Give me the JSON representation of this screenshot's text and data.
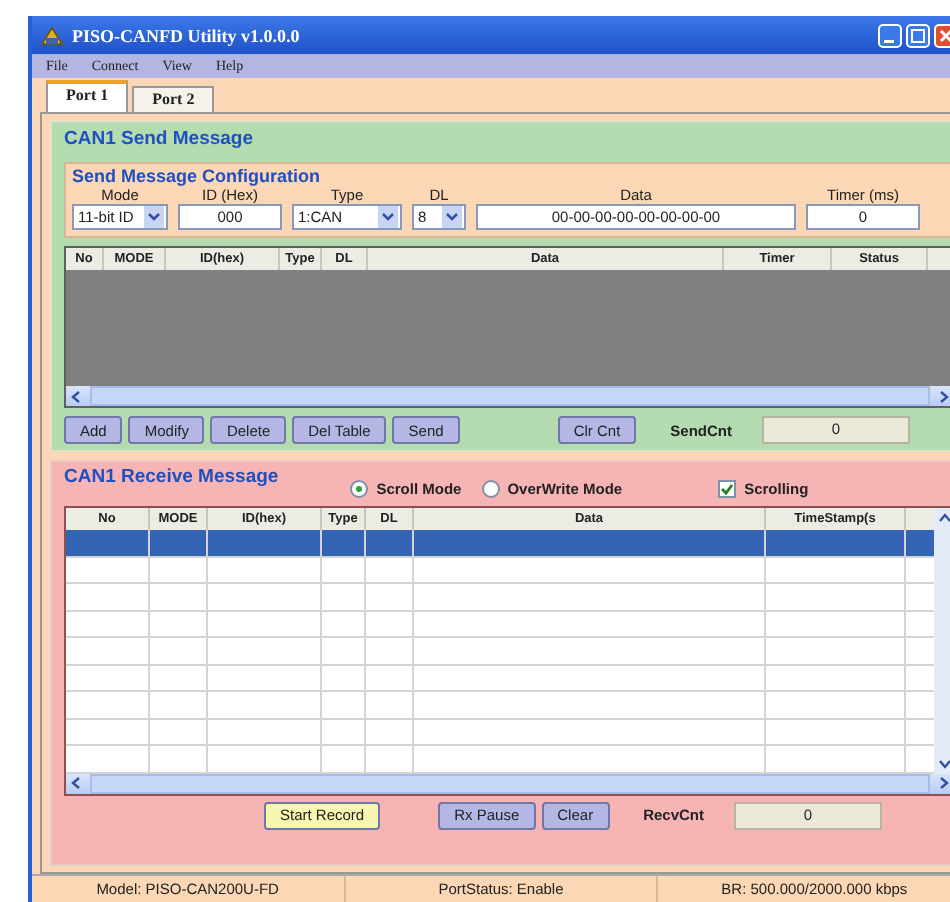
{
  "window": {
    "title": "PISO-CANFD Utility v1.0.0.0"
  },
  "menu": [
    "File",
    "Connect",
    "View",
    "Help"
  ],
  "tabs": [
    {
      "label": "Port 1",
      "selected": true
    },
    {
      "label": "Port 2",
      "selected": false
    }
  ],
  "send": {
    "title": "CAN1 Send Message",
    "config": {
      "title": "Send Message Configuration",
      "fields": [
        {
          "label": "Mode",
          "kind": "dropdown",
          "value": "11-bit ID"
        },
        {
          "label": "ID (Hex)",
          "kind": "text",
          "value": "000"
        },
        {
          "label": "Type",
          "kind": "dropdown",
          "value": "1:CAN"
        },
        {
          "label": "DL",
          "kind": "dropdown",
          "value": "8"
        },
        {
          "label": "Data",
          "kind": "text",
          "value": "00-00-00-00-00-00-00-00"
        },
        {
          "label": "Timer (ms)",
          "kind": "text",
          "value": "0"
        }
      ]
    },
    "table": {
      "columns": [
        "No",
        "MODE",
        "ID(hex)",
        "Type",
        "DL",
        "Data",
        "Timer",
        "Status"
      ]
    },
    "buttons": [
      "Add",
      "Modify",
      "Delete",
      "Del Table",
      "Send"
    ],
    "clear_button": "Clr Cnt",
    "counter": {
      "label": "SendCnt",
      "value": "0"
    }
  },
  "receive": {
    "title": "CAN1 Receive Message",
    "modes": [
      {
        "label": "Scroll Mode",
        "selected": true
      },
      {
        "label": "OverWrite Mode",
        "selected": false
      }
    ],
    "scrolling": {
      "label": "Scrolling",
      "checked": true
    },
    "table": {
      "columns": [
        "No",
        "MODE",
        "ID(hex)",
        "Type",
        "DL",
        "Data",
        "TimeStamp(s"
      ],
      "rows": [
        {
          "selected": true
        },
        {
          "selected": false
        },
        {
          "selected": false
        },
        {
          "selected": false
        },
        {
          "selected": false
        },
        {
          "selected": false
        },
        {
          "selected": false
        },
        {
          "selected": false
        },
        {
          "selected": false
        }
      ]
    },
    "buttons": [
      {
        "label": "Start Record",
        "kind": "record"
      },
      {
        "label": "Rx Pause",
        "kind": "normal"
      },
      {
        "label": "Clear",
        "kind": "normal"
      }
    ],
    "counter": {
      "label": "RecvCnt",
      "value": "0"
    }
  },
  "status_bar": [
    "Model: PISO-CAN200U-FD",
    "PortStatus: Enable",
    "BR: 500.000/2000.000 kbps"
  ]
}
